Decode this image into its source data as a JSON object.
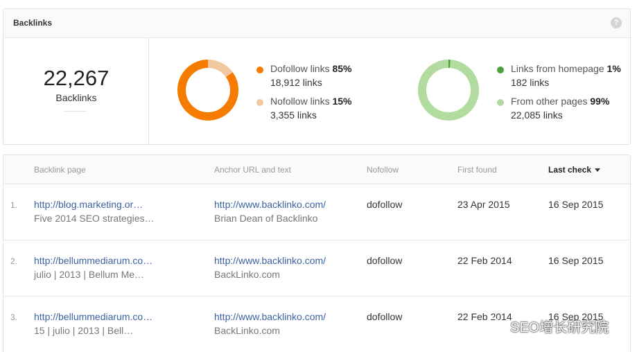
{
  "panel": {
    "title": "Backlinks",
    "help_icon": "question-icon",
    "help_glyph": "?"
  },
  "summary": {
    "total": "22,267",
    "total_label": "Backlinks"
  },
  "follow_chart": {
    "colors": {
      "dofollow": "#f57c00",
      "nofollow": "#f2c8a0"
    },
    "dofollow_fraction": 0.85,
    "nofollow_fraction": 0.15,
    "dofollow": {
      "label": "Dofollow links",
      "percent": "85%",
      "count": "18,912 links"
    },
    "nofollow": {
      "label": "Nofollow links",
      "percent": "15%",
      "count": "3,355 links"
    }
  },
  "source_chart": {
    "colors": {
      "homepage": "#4fa13b",
      "other": "#b2dba0"
    },
    "homepage_fraction": 0.01,
    "other_fraction": 0.99,
    "homepage": {
      "label": "Links from homepage",
      "percent": "1%",
      "count": "182 links"
    },
    "other": {
      "label": "From other pages",
      "percent": "99%",
      "count": "22,085 links"
    }
  },
  "table": {
    "columns": {
      "backlink_page": "Backlink page",
      "anchor": "Anchor URL and text",
      "nofollow": "Nofollow",
      "first_found": "First found",
      "last_check": "Last check"
    },
    "sort_icon": "caret-down-icon",
    "rows": [
      {
        "num": "1.",
        "page_url": "http://blog.marketing.or…",
        "page_title": "Five 2014 SEO strategies…",
        "anchor_url": "http://www.backlinko.com/",
        "anchor_text": "Brian Dean of Backlinko",
        "follow": "dofollow",
        "first_found": "23 Apr 2015",
        "last_check": "16 Sep 2015"
      },
      {
        "num": "2.",
        "page_url": "http://bellummediarum.co…",
        "page_title": "julio | 2013 | Bellum Me…",
        "anchor_url": "http://www.backlinko.com/",
        "anchor_text": "BackLinko.com",
        "follow": "dofollow",
        "first_found": "22 Feb 2014",
        "last_check": "16 Sep 2015"
      },
      {
        "num": "3.",
        "page_url": "http://bellummediarum.co…",
        "page_title": "15 | julio | 2013 | Bell…",
        "anchor_url": "http://www.backlinko.com/",
        "anchor_text": "BackLinko.com",
        "follow": "dofollow",
        "first_found": "22 Feb 2014",
        "last_check": "16 Sep 2015"
      }
    ]
  },
  "watermark": {
    "icon": "wechat-icon",
    "text": "SEO增长研究院"
  }
}
